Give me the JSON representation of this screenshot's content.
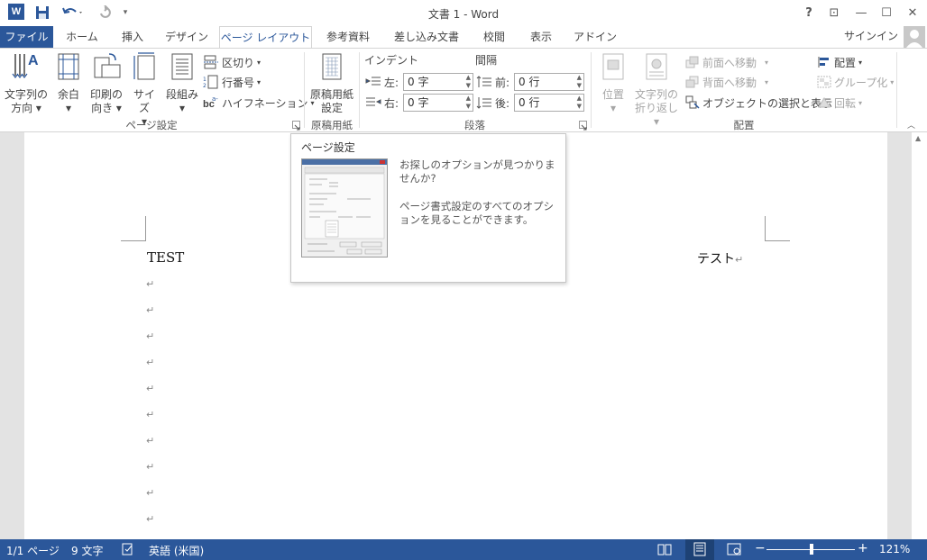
{
  "app": {
    "title": "文書 1 - Word",
    "logo": "W"
  },
  "qat": {
    "save_icon": "save-icon",
    "undo_icon": "undo-icon",
    "redo_icon": "redo-icon",
    "customize_icon": "customize-icon"
  },
  "window": {
    "help": "?",
    "ribbon_display": "⊡",
    "minimize": "—",
    "maximize": "☐",
    "close": "✕"
  },
  "tabs": {
    "file": "ファイル",
    "home": "ホーム",
    "insert": "挿入",
    "design": "デザイン",
    "layout": "ページ レイアウト",
    "references": "参考資料",
    "mailings": "差し込み文書",
    "review": "校閲",
    "view": "表示",
    "addins": "アドイン"
  },
  "signin": "サインイン",
  "ribbon": {
    "page_setup": {
      "label": "ページ設定",
      "text_direction": [
        "文字列の",
        "方向"
      ],
      "margins": "余白",
      "orientation": [
        "印刷の",
        "向き"
      ],
      "size": "サイズ",
      "columns": "段組み",
      "breaks": "区切り",
      "line_numbers": "行番号",
      "hyphenation": "ハイフネーション"
    },
    "manuscript": {
      "label": "原稿用紙",
      "button": [
        "原稿用紙",
        "設定"
      ]
    },
    "paragraph": {
      "label": "段落",
      "indent_header": "インデント",
      "spacing_header": "間隔",
      "left_label": "左:",
      "left_value": "0 字",
      "right_label": "右:",
      "right_value": "0 字",
      "before_label": "前:",
      "before_value": "0 行",
      "after_label": "後:",
      "after_value": "0 行"
    },
    "arrange": {
      "label": "配置",
      "position": "位置",
      "wrap_text": [
        "文字列の",
        "折り返し"
      ],
      "bring_forward": "前面へ移動",
      "send_backward": "背面へ移動",
      "selection_pane": "オブジェクトの選択と表示",
      "align": "配置",
      "group": "グループ化",
      "rotate": "回転"
    }
  },
  "tooltip": {
    "title": "ページ設定",
    "text1": "お探しのオプションが見つかりませんか?",
    "text2": "ページ書式設定のすべてのオプションを見ることができます。"
  },
  "document": {
    "left_text": "TEST",
    "right_text": "テスト",
    "para_mark": "↵"
  },
  "status": {
    "page": "1/1 ページ",
    "words": "9 文字",
    "language": "英語 (米国)",
    "zoom": "121%"
  },
  "colors": {
    "accent": "#2b579a"
  }
}
